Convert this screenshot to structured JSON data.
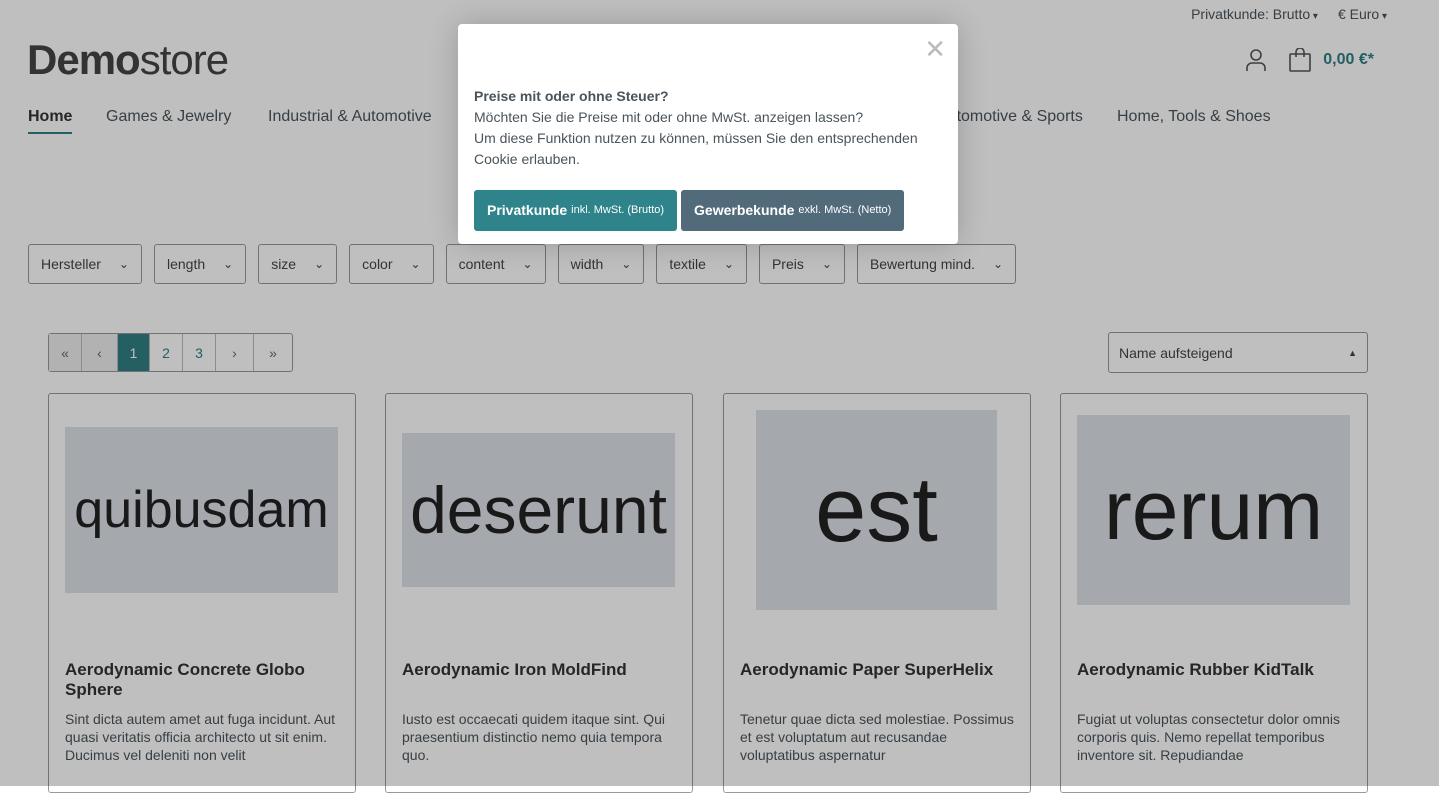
{
  "topbar": {
    "tax": "Privatkunde: Brutto",
    "currency": "€ Euro"
  },
  "logo": {
    "bold": "Demo",
    "light": "store"
  },
  "cart": {
    "total": "0,00 €*"
  },
  "nav": [
    "Home",
    "Games & Jewelry",
    "Industrial & Automotive",
    "Automotive & Sports",
    "Home, Tools & Shoes"
  ],
  "filters": [
    "Hersteller",
    "length",
    "size",
    "color",
    "content",
    "width",
    "textile",
    "Preis",
    "Bewertung mind."
  ],
  "pager": [
    "«",
    "‹",
    "1",
    "2",
    "3",
    "›",
    "»"
  ],
  "sort": "Name aufsteigend",
  "products": [
    {
      "image_text": "quibusdam",
      "name": "Aerodynamic Concrete Globo Sphere",
      "desc": "Sint dicta autem amet aut fuga incidunt. Aut quasi veritatis officia architecto ut sit enim. Ducimus vel deleniti non velit"
    },
    {
      "image_text": "deserunt",
      "name": "Aerodynamic Iron MoldFind",
      "desc": "Iusto est occaecati quidem itaque sint. Qui praesentium distinctio nemo quia tempora quo."
    },
    {
      "image_text": "est",
      "name": "Aerodynamic Paper SuperHelix",
      "desc": "Tenetur quae dicta sed molestiae. Possimus et est voluptatum aut recusandae voluptatibus aspernatur"
    },
    {
      "image_text": "rerum",
      "name": "Aerodynamic Rubber KidTalk",
      "desc": "Fugiat ut voluptas consectetur dolor omnis corporis quis. Nemo repellat temporibus inventore sit. Repudiandae"
    }
  ],
  "modal": {
    "title": "Preise mit oder ohne Steuer?",
    "line1": "Möchten Sie die Preise mit oder ohne MwSt. anzeigen lassen?",
    "line2": "Um diese Funktion nutzen zu können, müssen Sie den entsprechenden Cookie erlauben.",
    "btn1": "Privatkunde",
    "btn1_small": "inkl. MwSt. (Brutto)",
    "btn2": "Gewerbekunde",
    "btn2_small": "exkl. MwSt. (Netto)"
  },
  "colors": {
    "primary": "#2f848b",
    "secondary": "#526b7b"
  }
}
